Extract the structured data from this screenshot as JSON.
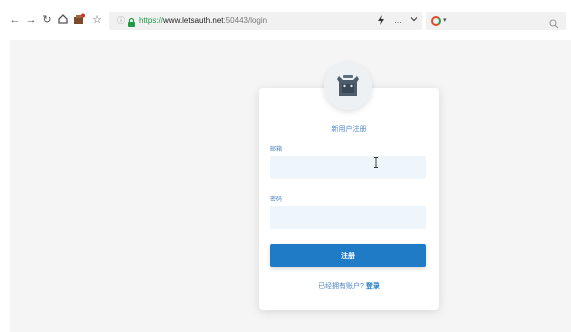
{
  "browser": {
    "url_protocol": "https://",
    "url_host": "www.letsauth.net",
    "url_path": ":50443/login",
    "menu_glyph": "…"
  },
  "form": {
    "title": "新用户注册",
    "email_label": "邮箱",
    "email_value": "",
    "password_label": "密码",
    "password_value": "",
    "submit_label": "注册",
    "footer_text": "已经拥有账户?",
    "login_link": "登录"
  },
  "colors": {
    "accent": "#1f7bc5",
    "label": "#4d86c6",
    "input_bg": "#eef5fb",
    "page_bg": "#f5f5f5"
  }
}
